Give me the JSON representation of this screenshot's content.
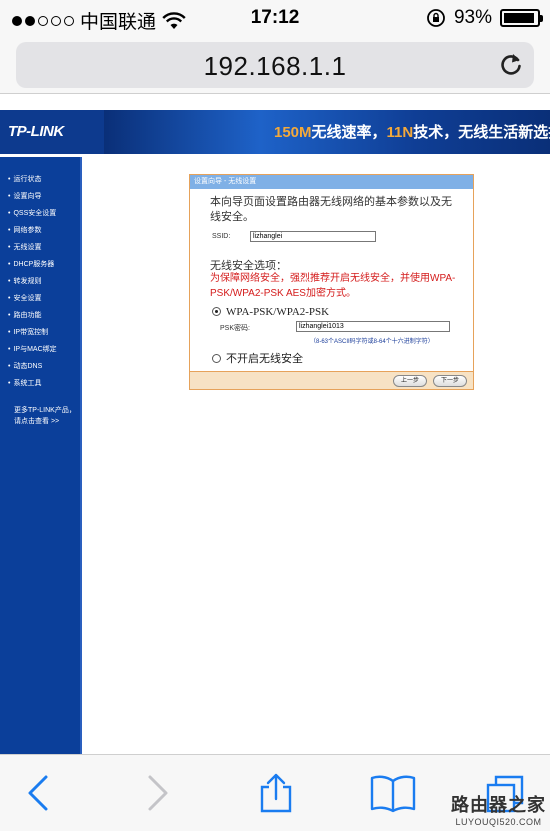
{
  "status_bar": {
    "carrier": "中国联通",
    "time": "17:12",
    "battery_percent": "93%",
    "battery_level": 0.93,
    "signal_icons": [
      "signal-dot",
      "wifi-icon",
      "rotation-lock-icon",
      "battery-icon"
    ]
  },
  "browser": {
    "url": "192.168.1.1",
    "reload_icon": "reload-icon"
  },
  "router_page": {
    "logo": "TP-LINK",
    "slogan_parts": [
      "150M",
      "无线速率，",
      "11N",
      "技术，无线生活新选择"
    ],
    "sidebar": {
      "items": [
        "运行状态",
        "设置向导",
        "QSS安全设置",
        "网络参数",
        "无线设置",
        "DHCP服务器",
        "转发规则",
        "安全设置",
        "路由功能",
        "IP带宽控制",
        "IP与MAC绑定",
        "动态DNS",
        "系统工具"
      ],
      "more_line1": "更多TP-LINK产品，",
      "more_line2": "请点击查看 >>"
    },
    "wizard": {
      "title": "设置向导 - 无线设置",
      "intro": "本向导页面设置路由器无线网络的基本参数以及无线安全。",
      "ssid_label": "SSID:",
      "ssid_value": "lizhanglei",
      "security_heading": "无线安全选项：",
      "warning": "为保障网络安全，强烈推荐开启无线安全，并使用WPA-PSK/WPA2-PSK AES加密方式。",
      "option_wpa": "WPA-PSK/WPA2-PSK",
      "psk_label": "PSK密码:",
      "psk_value": "lizhanglei1013",
      "psk_hint": "（8-63个ASCII码字符或8-64个十六进制字符）",
      "option_none": "不开启无线安全",
      "prev_button": "上一步",
      "next_button": "下一步"
    }
  },
  "toolbar": {
    "icons": [
      "back-icon",
      "forward-icon",
      "share-icon",
      "bookmarks-icon",
      "tabs-icon"
    ]
  },
  "watermark": {
    "cn": "路由器之家",
    "en": "LUYOUQI520.COM"
  },
  "colors": {
    "router_blue": "#0b3f9a",
    "warning_red": "#d41b1b",
    "ios_blue": "#1a7cf0"
  }
}
